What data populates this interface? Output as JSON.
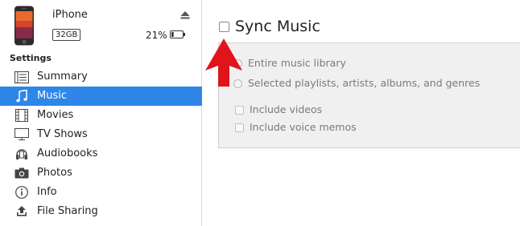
{
  "device": {
    "name": "iPhone",
    "capacity": "32GB",
    "battery_percent": "21%",
    "battery_level": 0.21,
    "eject_icon": "eject-icon"
  },
  "sidebar": {
    "heading": "Settings",
    "items": [
      {
        "label": "Summary",
        "icon": "summary-list-icon",
        "active": false
      },
      {
        "label": "Music",
        "icon": "music-note-icon",
        "active": true
      },
      {
        "label": "Movies",
        "icon": "film-strip-icon",
        "active": false
      },
      {
        "label": "TV Shows",
        "icon": "tv-monitor-icon",
        "active": false
      },
      {
        "label": "Audiobooks",
        "icon": "audiobook-icon",
        "active": false
      },
      {
        "label": "Photos",
        "icon": "camera-icon",
        "active": false
      },
      {
        "label": "Info",
        "icon": "info-icon",
        "active": false
      },
      {
        "label": "File Sharing",
        "icon": "file-sharing-icon",
        "active": false
      }
    ]
  },
  "main": {
    "sync_label": "Sync Music",
    "sync_checked": false,
    "options": {
      "entire_library": "Entire music library",
      "selected": "Selected playlists, artists, albums, and genres",
      "include_videos": "Include videos",
      "include_voice_memos": "Include voice memos"
    }
  },
  "colors": {
    "selection": "#2e86e8",
    "annotation_arrow": "#e0141b",
    "panel_bg": "#f0f0f0"
  }
}
